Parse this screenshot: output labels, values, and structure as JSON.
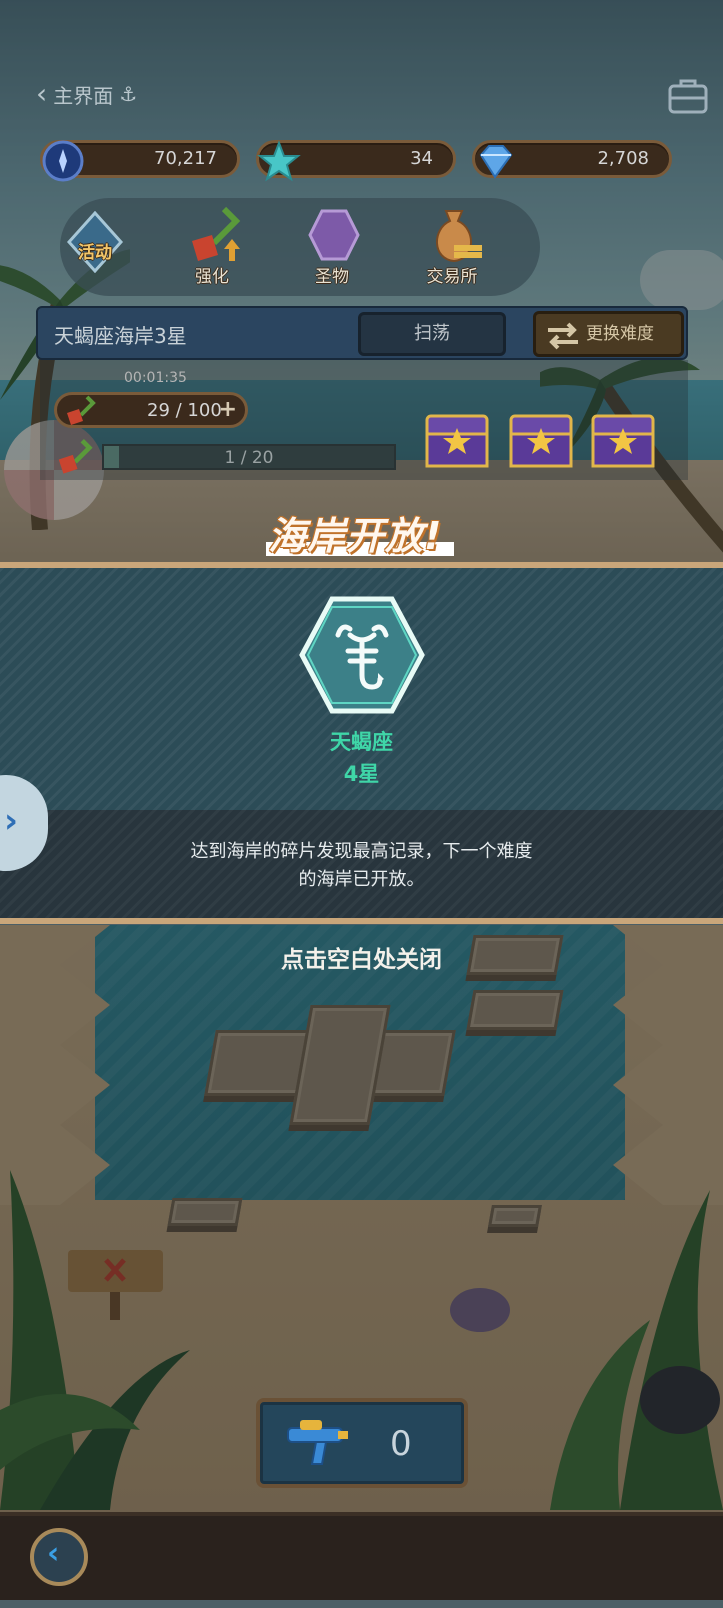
{
  "header": {
    "back_label": "主界面",
    "back_icon": "chevron-left-icon",
    "anchor_icon": "anchor-icon",
    "toolbox_icon": "toolbox-icon"
  },
  "resources": [
    {
      "icon": "compass-coin-icon",
      "value": "70,217"
    },
    {
      "icon": "starfish-icon",
      "value": "34"
    },
    {
      "icon": "gem-icon",
      "value": "2,708"
    }
  ],
  "menu": {
    "items": [
      {
        "label": "活动",
        "icon": "event-badge-icon"
      },
      {
        "label": "强化",
        "icon": "shovel-upgrade-icon"
      },
      {
        "label": "圣物",
        "icon": "relic-icon"
      },
      {
        "label": "交易所",
        "icon": "treasure-bag-icon"
      }
    ]
  },
  "stage": {
    "title": "天蝎座海岸3星",
    "sweep_label": "扫荡",
    "change_difficulty_label": "更换难度",
    "timer": "00:01:35",
    "shovel_count": "29 / 100",
    "progress_text": "1 / 20",
    "progress_fraction": 0.05
  },
  "popup": {
    "headline": "海岸开放!",
    "constellation_name": "天蝎座",
    "stars": "4星",
    "description_line1": "达到海岸的碎片发现最高记录，下一个难度",
    "description_line2": "的海岸已开放。",
    "icon": "scorpion-icon",
    "accent": "#3fd6a8"
  },
  "close_hint": "点击空白处关闭",
  "item": {
    "icon": "water-gun-icon",
    "count": "0"
  },
  "colors": {
    "popup_bg": "#2c4c57",
    "border_gold": "#c9a67a",
    "side_arrow": "#2f6fb6"
  }
}
